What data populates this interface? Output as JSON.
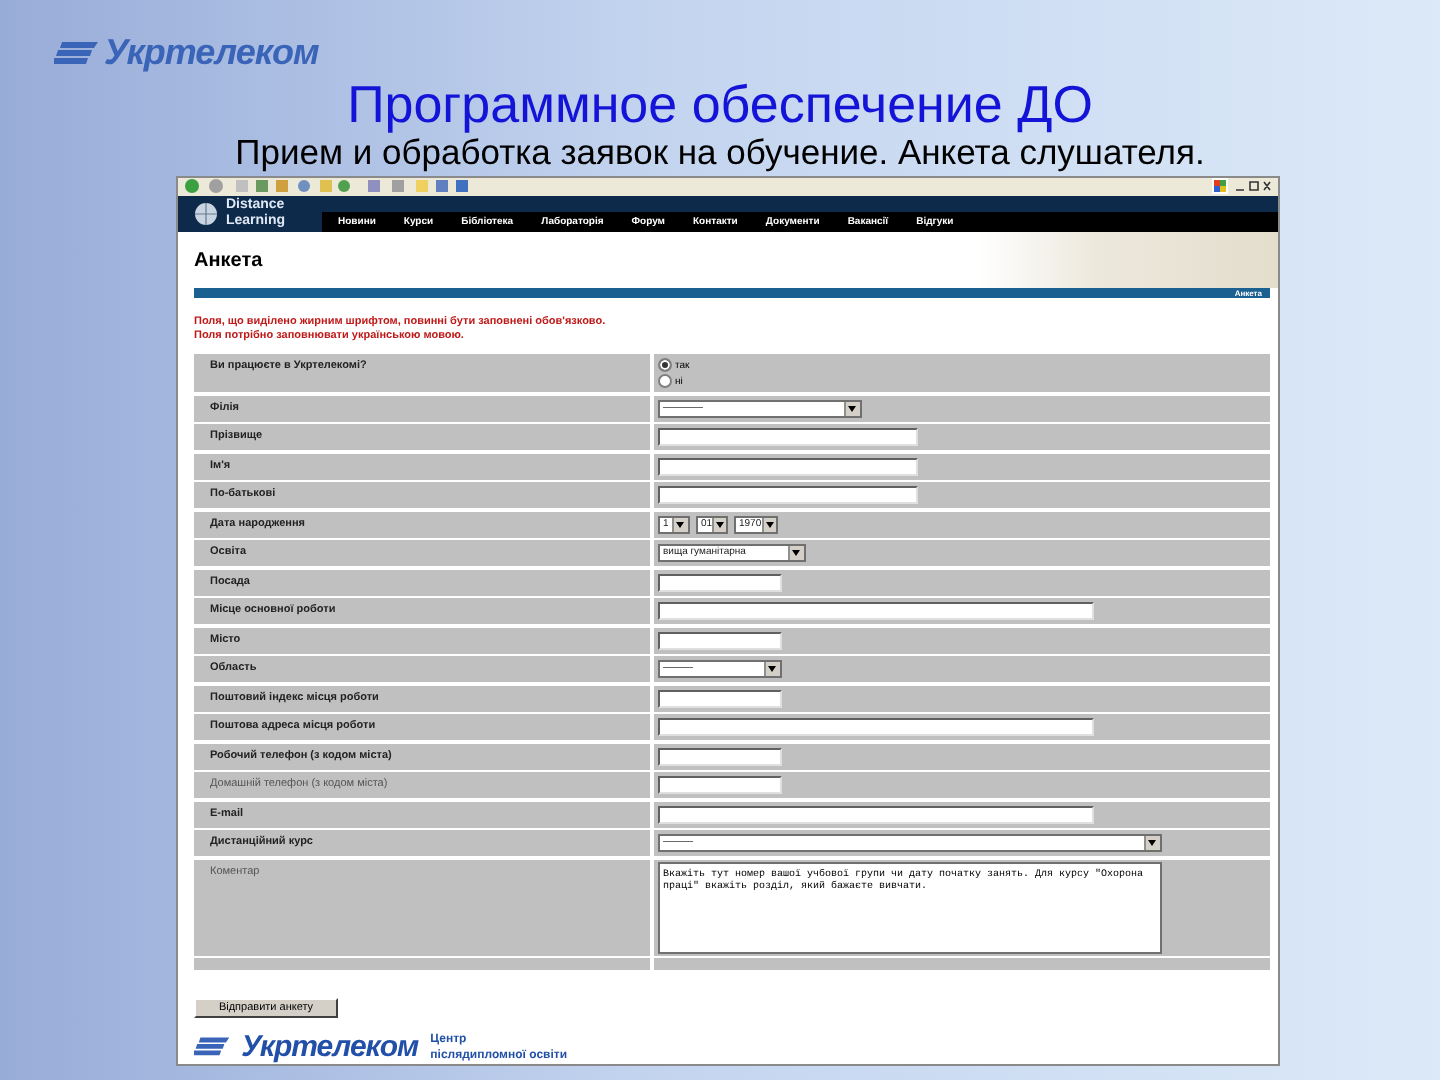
{
  "slide": {
    "logo": "Укртелеком",
    "title": "Программное обеспечение ДО",
    "subtitle": "Прием и обработка заявок на обучение. Анкета слушателя."
  },
  "site": {
    "brand_lines": [
      "Distance",
      "Learning"
    ],
    "nav": [
      "Новини",
      "Курси",
      "Бібліотека",
      "Лабораторія",
      "Форум",
      "Контакти",
      "Документи",
      "Вакансії",
      "Відгуки"
    ],
    "page_title": "Анкета",
    "breadcrumb": "Анкета",
    "notices": [
      "Поля, що виділено жирним шрифтом, повинні бути заповнені обов'язково.",
      "Поля потрібно заповнювати українською мовою."
    ]
  },
  "form": {
    "fields": [
      {
        "label": "Ви працюєте в Укртелекомі?",
        "required": true,
        "kind": "radio",
        "options": [
          {
            "label": "так",
            "selected": true
          },
          {
            "label": "ні",
            "selected": false
          }
        ]
      },
      {
        "label": "Філія",
        "required": true,
        "kind": "wideselect",
        "value": "————"
      },
      {
        "label": "Прізвище",
        "required": true,
        "kind": "input"
      },
      {
        "label": "Ім'я",
        "required": true,
        "kind": "input"
      },
      {
        "label": "По-батькові",
        "required": true,
        "kind": "input"
      },
      {
        "label": "Дата народження",
        "required": true,
        "kind": "date",
        "values": [
          "1",
          "01",
          "1970"
        ]
      },
      {
        "label": "Освіта",
        "required": true,
        "kind": "select",
        "value": "вища гуманітарна"
      },
      {
        "label": "Посада",
        "required": true,
        "kind": "shortinput"
      },
      {
        "label": "Місце основної роботи",
        "required": true,
        "kind": "longinput"
      },
      {
        "label": "Місто",
        "required": true,
        "kind": "shortinput"
      },
      {
        "label": "Область",
        "required": true,
        "kind": "shortselect",
        "value": "———"
      },
      {
        "label": "Поштовий індекс місця роботи",
        "required": true,
        "kind": "shortinput"
      },
      {
        "label": "Поштова адреса місця роботи",
        "required": true,
        "kind": "longinput"
      },
      {
        "label": "Робочий телефон (з кодом міста)",
        "required": true,
        "kind": "shortinput"
      },
      {
        "label": "Домашній телефон (з кодом міста)",
        "required": false,
        "kind": "shortinput"
      },
      {
        "label": "E-mail",
        "required": true,
        "kind": "longinput"
      },
      {
        "label": "Дистанційний курс",
        "required": true,
        "kind": "longselect",
        "value": "———"
      },
      {
        "label": "Коментар",
        "required": false,
        "kind": "textarea",
        "value": "Вкажіть тут номер вашої учбової групи чи дату початку занять. Для курсу \"Охорона праці\" вкажіть розділ, який бажаєте вивчати."
      },
      {
        "kind": "empty"
      }
    ],
    "submit": "Відправити анкету"
  },
  "footer": {
    "logo": "Укртелеком",
    "lines": [
      "Центр",
      "післядипломної освіти"
    ]
  }
}
